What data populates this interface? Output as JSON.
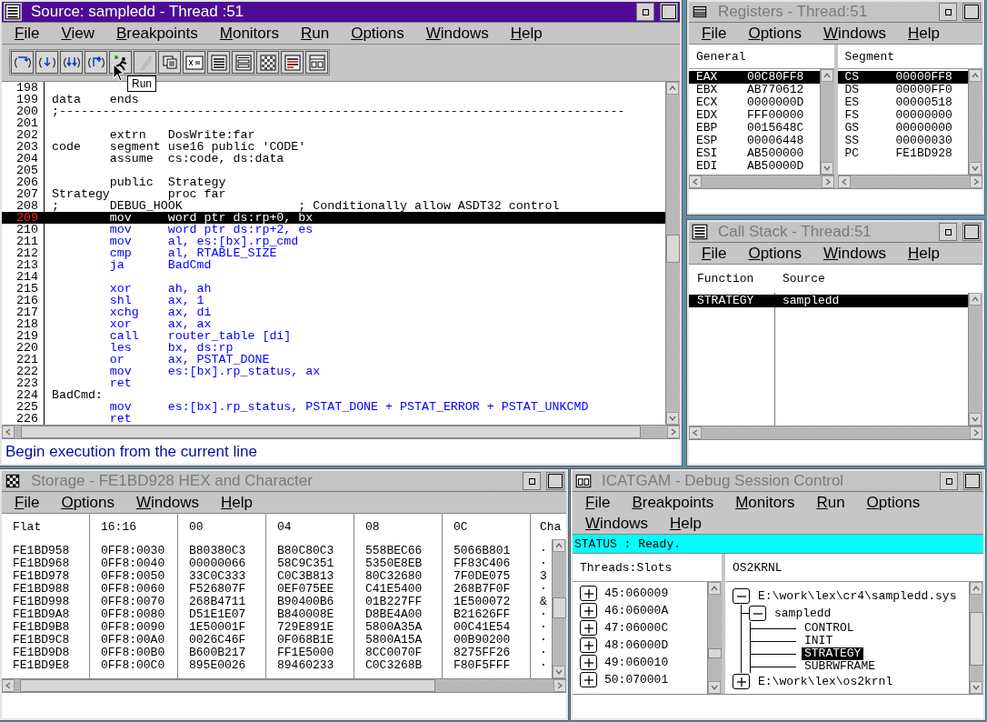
{
  "source": {
    "title": "Source: sampledd - Thread :51",
    "active": true,
    "menu": [
      "File",
      "View",
      "Breakpoints",
      "Monitors",
      "Run",
      "Options",
      "Windows",
      "Help"
    ],
    "toolbar": [
      {
        "kind": "braces-right",
        "disabled": false
      },
      {
        "kind": "braces-down",
        "disabled": false
      },
      {
        "kind": "braces-double",
        "disabled": false
      },
      {
        "kind": "braces-return",
        "disabled": false
      },
      {
        "kind": "runner",
        "disabled": false
      },
      {
        "kind": "pen",
        "disabled": true
      },
      {
        "kind": "pages",
        "disabled": false
      },
      {
        "kind": "x-equals",
        "disabled": false
      },
      {
        "kind": "list",
        "disabled": false
      },
      {
        "kind": "panel",
        "disabled": false
      },
      {
        "kind": "checker",
        "disabled": false
      },
      {
        "kind": "list-red",
        "disabled": false
      },
      {
        "kind": "window",
        "disabled": false
      }
    ],
    "tooltip": "Run",
    "lines": [
      {
        "num": "198",
        "current": false
      },
      {
        "num": "199",
        "text": "data    ends",
        "executable": false,
        "current": false
      },
      {
        "num": "200",
        "text": ";------------------------------------------------------------------------------",
        "executable": false,
        "current": false
      },
      {
        "num": "201",
        "current": false
      },
      {
        "num": "202",
        "text": "        extrn   DosWrite:far",
        "executable": false,
        "current": false
      },
      {
        "num": "203",
        "text": "code    segment use16 public 'CODE'",
        "executable": false,
        "current": false
      },
      {
        "num": "204",
        "text": "        assume  cs:code, ds:data",
        "executable": false,
        "current": false
      },
      {
        "num": "205",
        "current": false
      },
      {
        "num": "206",
        "text": "        public  Strategy",
        "executable": false,
        "current": false
      },
      {
        "num": "207",
        "text": "Strategy        proc far",
        "executable": false,
        "current": false
      },
      {
        "num": "208",
        "text": ";       DEBUG_HOOK                ; Conditionally allow ASDT32 control",
        "executable": false,
        "current": false
      },
      {
        "num": "209",
        "text": "        mov     word ptr ds:rp+0, bx",
        "executable": true,
        "current": true
      },
      {
        "num": "210",
        "text": "        mov     word ptr ds:rp+2, es",
        "executable": true,
        "current": false
      },
      {
        "num": "211",
        "text": "        mov     al, es:[bx].rp_cmd",
        "executable": true,
        "current": false
      },
      {
        "num": "212",
        "text": "        cmp     al, RTABLE_SIZE",
        "executable": true,
        "current": false
      },
      {
        "num": "213",
        "text": "        ja      BadCmd",
        "executable": true,
        "current": false
      },
      {
        "num": "214",
        "current": false
      },
      {
        "num": "215",
        "text": "        xor     ah, ah",
        "executable": true,
        "current": false
      },
      {
        "num": "216",
        "text": "        shl     ax, 1",
        "executable": true,
        "current": false
      },
      {
        "num": "217",
        "text": "        xchg    ax, di",
        "executable": true,
        "current": false
      },
      {
        "num": "218",
        "text": "        xor     ax, ax",
        "executable": true,
        "current": false
      },
      {
        "num": "219",
        "text": "        call    router_table [di]",
        "executable": true,
        "current": false
      },
      {
        "num": "220",
        "text": "        les     bx, ds:rp",
        "executable": true,
        "current": false
      },
      {
        "num": "221",
        "text": "        or      ax, PSTAT_DONE",
        "executable": true,
        "current": false
      },
      {
        "num": "222",
        "text": "        mov     es:[bx].rp_status, ax",
        "executable": true,
        "current": false
      },
      {
        "num": "223",
        "text": "        ret",
        "executable": true,
        "current": false
      },
      {
        "num": "224",
        "text": "BadCmd:",
        "executable": false,
        "current": false
      },
      {
        "num": "225",
        "text": "        mov     es:[bx].rp_status, PSTAT_DONE + PSTAT_ERROR + PSTAT_UNKCMD",
        "executable": true,
        "current": false
      },
      {
        "num": "226",
        "text": "        ret",
        "executable": true,
        "current": false
      }
    ],
    "message": "Begin execution from the current line"
  },
  "registers": {
    "title": "Registers - Thread:51",
    "active": false,
    "menu": [
      "File",
      "Options",
      "Windows",
      "Help"
    ],
    "general": {
      "heading": "General",
      "rows": [
        {
          "name": "EAX",
          "value": "00C80FF8",
          "selected": true
        },
        {
          "name": "EBX",
          "value": "AB770612",
          "selected": false
        },
        {
          "name": "ECX",
          "value": "0000000D",
          "selected": false
        },
        {
          "name": "EDX",
          "value": "FFF00000",
          "selected": false
        },
        {
          "name": "EBP",
          "value": "0015648C",
          "selected": false
        },
        {
          "name": "ESP",
          "value": "00006448",
          "selected": false
        },
        {
          "name": "ESI",
          "value": "AB500000",
          "selected": false
        },
        {
          "name": "EDI",
          "value": "AB50000D",
          "selected": false
        }
      ]
    },
    "segment": {
      "heading": "Segment",
      "rows": [
        {
          "name": "CS",
          "value": "00000FF8",
          "selected": true
        },
        {
          "name": "DS",
          "value": "00000FF0",
          "selected": false
        },
        {
          "name": "ES",
          "value": "00000518",
          "selected": false
        },
        {
          "name": "FS",
          "value": "00000000",
          "selected": false
        },
        {
          "name": "GS",
          "value": "00000000",
          "selected": false
        },
        {
          "name": "SS",
          "value": "00000030",
          "selected": false
        },
        {
          "name": "PC",
          "value": "FE1BD928",
          "selected": false
        }
      ]
    }
  },
  "call_stack": {
    "title": "Call Stack - Thread:51",
    "active": false,
    "menu": [
      "File",
      "Options",
      "Windows",
      "Help"
    ],
    "columns": [
      "Function",
      "Source"
    ],
    "rows": [
      {
        "cells": [
          "STRATEGY",
          "sampledd"
        ],
        "selected": true
      }
    ]
  },
  "storage": {
    "title": "Storage - FE1BD928 HEX and Character",
    "active": false,
    "menu": [
      "File",
      "Options",
      "Windows",
      "Help"
    ],
    "columns": [
      "Flat",
      "16:16",
      "00",
      "04",
      "08",
      "0C",
      "Cha"
    ],
    "rows": [
      {
        "cells": [
          "FE1BD958",
          "0FF8:0030",
          "B80380C3",
          "B80C80C3",
          "558BEC66",
          "5066B801",
          "·"
        ]
      },
      {
        "cells": [
          "FE1BD968",
          "0FF8:0040",
          "00000066",
          "58C9C351",
          "5350E8EB",
          "FF83C406",
          "·"
        ]
      },
      {
        "cells": [
          "FE1BD978",
          "0FF8:0050",
          "33C0C333",
          "C0C3B813",
          "80C32680",
          "7F0DE075",
          "3"
        ]
      },
      {
        "cells": [
          "FE1BD988",
          "0FF8:0060",
          "F526807F",
          "0EF075EE",
          "C41E5400",
          "268B7F0F",
          "·"
        ]
      },
      {
        "cells": [
          "FE1BD998",
          "0FF8:0070",
          "268B4711",
          "B90400B6",
          "01B227FF",
          "1E500072",
          "&"
        ]
      },
      {
        "cells": [
          "FE1BD9A8",
          "0FF8:0080",
          "D51E1E07",
          "B840008E",
          "D8BE4A00",
          "B21626FF",
          "·"
        ]
      },
      {
        "cells": [
          "FE1BD9B8",
          "0FF8:0090",
          "1E50001F",
          "729E891E",
          "5800A35A",
          "00C41E54",
          "·"
        ]
      },
      {
        "cells": [
          "FE1BD9C8",
          "0FF8:00A0",
          "0026C46F",
          "0F068B1E",
          "5800A15A",
          "00B90200",
          "·"
        ]
      },
      {
        "cells": [
          "FE1BD9D8",
          "0FF8:00B0",
          "B600B217",
          "FF1E5000",
          "8CC0070F",
          "8275FF26",
          "·"
        ]
      },
      {
        "cells": [
          "FE1BD9E8",
          "0FF8:00C0",
          "895E0026",
          "89460233",
          "C0C3268B",
          "F80F5FFF",
          "·"
        ]
      }
    ]
  },
  "session": {
    "title": "ICATGAM - Debug Session Control",
    "active": false,
    "menu": [
      "File",
      "Breakpoints",
      "Monitors",
      "Run",
      "Options",
      "Windows",
      "Help"
    ],
    "status": "STATUS : Ready.",
    "threads": {
      "heading": "Threads:Slots",
      "items": [
        {
          "label": "45:060009",
          "expanded": false
        },
        {
          "label": "46:06000A",
          "expanded": false
        },
        {
          "label": "47:06000C",
          "expanded": false
        },
        {
          "label": "48:06000D",
          "expanded": false
        },
        {
          "label": "49:060010",
          "expanded": false
        },
        {
          "label": "50:070001",
          "expanded": false
        }
      ]
    },
    "modules": {
      "heading": "OS2KRNL",
      "tree": [
        {
          "label": "E:\\work\\lex\\cr4\\sampledd.sys",
          "expanded": true,
          "selected": false,
          "children": [
            {
              "label": "sampledd",
              "expanded": true,
              "selected": false,
              "children": [
                {
                  "label": "CONTROL",
                  "selected": false
                },
                {
                  "label": "INIT",
                  "selected": false
                },
                {
                  "label": "STRATEGY",
                  "selected": true
                },
                {
                  "label": "SUBRWFRAME",
                  "selected": false
                }
              ]
            }
          ]
        },
        {
          "label": "E:\\work\\lex\\os2krnl",
          "expanded": false,
          "selected": false
        }
      ]
    }
  }
}
